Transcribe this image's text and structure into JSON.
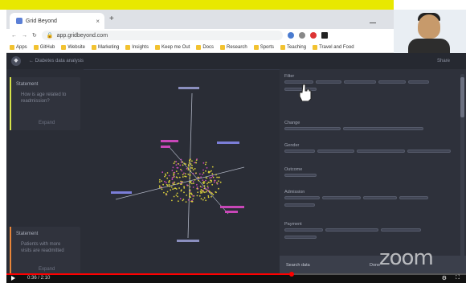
{
  "browser": {
    "tab_title": "Grid Beyond",
    "address": "app.gridbeyond.com",
    "bookmarks": [
      "Apps",
      "GitHub",
      "Website",
      "Marketing",
      "Insights",
      "Keep me Out",
      "Docs",
      "Research",
      "Sports",
      "Teaching",
      "Travel and Food"
    ]
  },
  "camera": {
    "name": ""
  },
  "app": {
    "breadcrumb": "← Diabetes data analysis",
    "header_right": "Share",
    "cards": [
      {
        "title": "Statement",
        "desc": "How is age related to readmission?",
        "meta": "Expand",
        "color": "#d7e34a"
      },
      {
        "title": "Statement",
        "desc": "Patients with more visits are readmitted",
        "meta": "Expand",
        "color": "#e8863a"
      }
    ],
    "right_panel": {
      "sections": [
        "Filter",
        "Change",
        "Gender",
        "Outcome",
        "Admission",
        "Payment"
      ],
      "footer_left": "Search data",
      "footer_right": "Done"
    }
  },
  "watermark": "zoom",
  "player": {
    "time": "0:36 / 2:10",
    "progress": 0.62
  },
  "colors": {
    "app_bg": "#2a2d36",
    "accent_yellow": "#d7e34a",
    "accent_orange": "#e8863a",
    "points_yellow": "#d9cf3a",
    "points_magenta": "#c847b8"
  }
}
